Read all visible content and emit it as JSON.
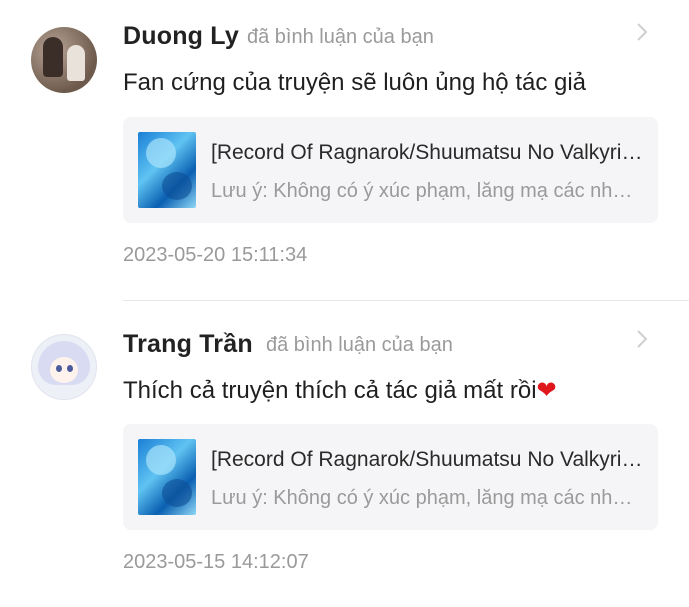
{
  "notifications": [
    {
      "user_name": "Duong Ly",
      "action_text": "đã bình luận của bạn",
      "comment": "Fan cứng của truyện sẽ luôn ủng hộ tác giả",
      "emoji": "",
      "card": {
        "title": "[Record Of Ragnarok/Shuumatsu No Valkyrie] Mối Quan Hệ",
        "description": "Lưu ý: Không có ý xúc phạm, lăng mạ các nhân vật"
      },
      "timestamp": "2023-05-20 15:11:34"
    },
    {
      "user_name": "Trang Trần",
      "action_text": "đã bình luận của bạn",
      "comment": "Thích cả truyện thích cả tác giả mất rồi",
      "emoji": "❤",
      "card": {
        "title": "[Record Of Ragnarok/Shuumatsu No Valkyrie] Mối Quan Hệ",
        "description": "Lưu ý: Không có ý xúc phạm, lăng mạ các nhân vật"
      },
      "timestamp": "2023-05-15 14:12:07"
    }
  ],
  "icons": {
    "chevron": "chevron-right-icon"
  },
  "colors": {
    "heart": "#e0161d",
    "muted_text": "#9a9a9a",
    "card_bg": "#f5f5f7"
  }
}
